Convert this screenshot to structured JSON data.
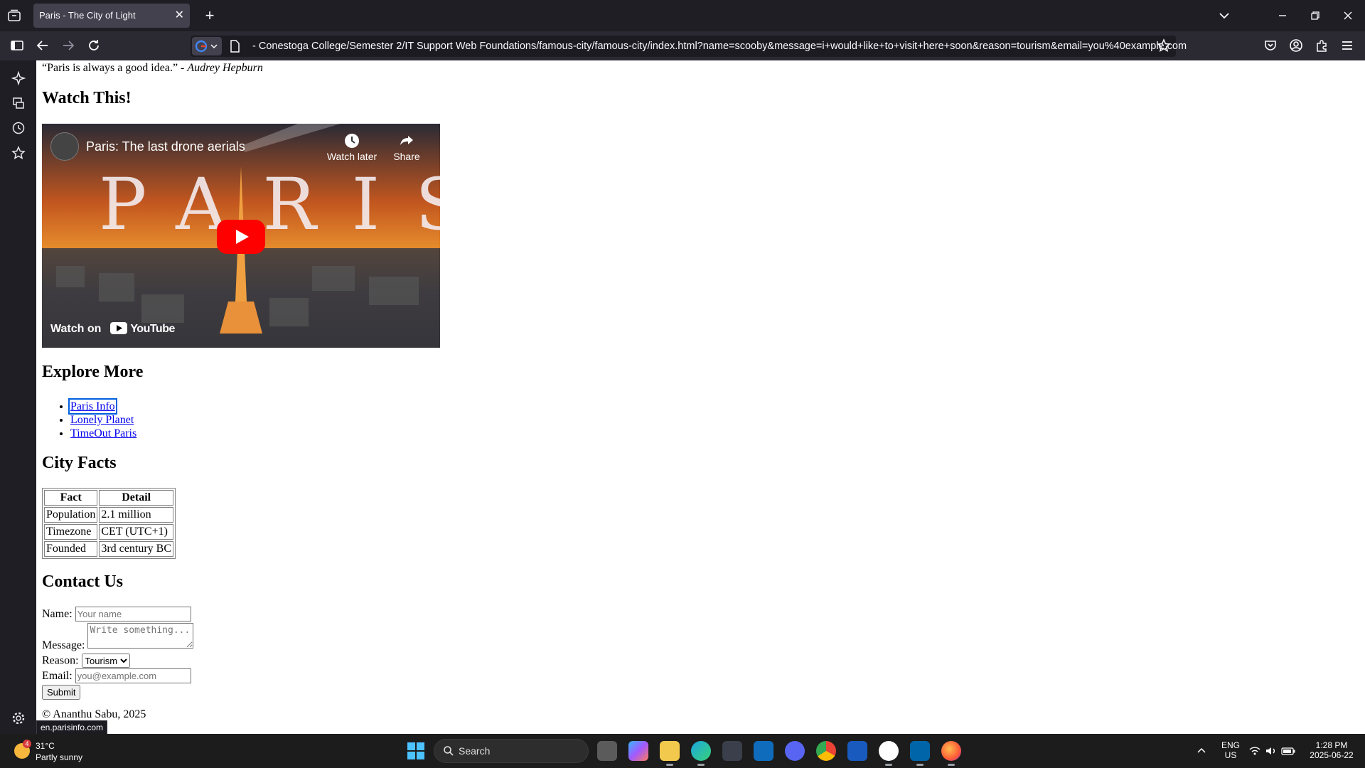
{
  "browser": {
    "tab_title": "Paris - The City of Light",
    "tab_close": "✕",
    "new_tab": "+",
    "url": "- Conestoga College/Semester 2/IT Support Web Foundations/famous-city/famous-city/index.html?name=scooby&message=i+would+like+to+visit+here+soon&reason=tourism&email=you%40example.com",
    "status_url": "en.parisinfo.com"
  },
  "page": {
    "quote_text": "“Paris is always a good idea.” - ",
    "quote_author": "Audrey Hepburn",
    "watch_heading": "Watch This!",
    "video": {
      "title": "Paris: The last drone aerials",
      "watch_later": "Watch later",
      "share": "Share",
      "watch_on": "Watch on",
      "youtube": "YouTube",
      "overlay_word": "PARIS"
    },
    "explore_heading": "Explore More",
    "links": [
      "Paris Info",
      "Lonely Planet",
      "TimeOut Paris"
    ],
    "facts_heading": "City Facts",
    "facts_headers": [
      "Fact",
      "Detail"
    ],
    "facts_rows": [
      [
        "Population",
        "2.1 million"
      ],
      [
        "Timezone",
        "CET (UTC+1)"
      ],
      [
        "Founded",
        "3rd century BC"
      ]
    ],
    "contact_heading": "Contact Us",
    "form": {
      "name_label": "Name:",
      "name_placeholder": "Your name",
      "message_label": "Message:",
      "message_placeholder": "Write something...",
      "reason_label": "Reason:",
      "reason_value": "Tourism",
      "email_label": "Email:",
      "email_placeholder": "you@example.com",
      "submit_label": "Submit"
    },
    "copyright": "© Ananthu Sabu, 2025"
  },
  "taskbar": {
    "weather_temp": "31°C",
    "weather_cond": "Partly sunny",
    "weather_badge": "4",
    "search_label": "Search",
    "lang_top": "ENG",
    "lang_bottom": "US",
    "time": "1:28 PM",
    "date": "2025-06-22"
  },
  "colors": {
    "link": "#0000ee",
    "youtube_red": "#ff0000",
    "chrome_bg": "#1f1e25",
    "taskbar_bg": "#1c1c1c"
  }
}
